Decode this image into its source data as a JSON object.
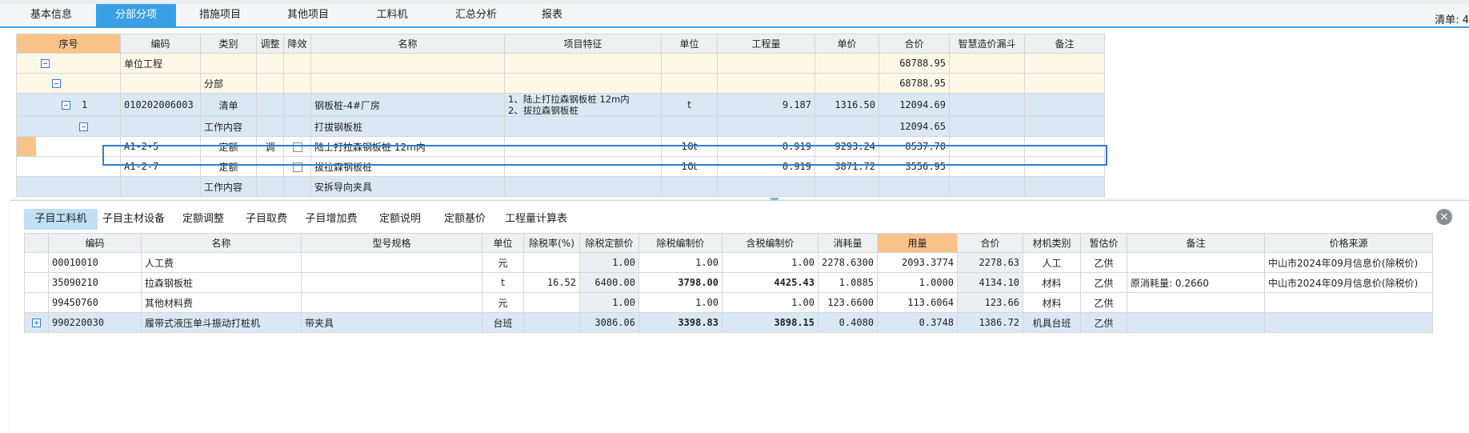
{
  "top_tabs": [
    "基本信息",
    "分部分项",
    "措施项目",
    "其他项目",
    "工料机",
    "汇总分析",
    "报表"
  ],
  "active_top_tab": "分部分项",
  "list_right_label": "清单: 4",
  "upper_table": {
    "headers": [
      "序号",
      "编码",
      "类别",
      "调整",
      "降效",
      "名称",
      "项目特征",
      "单位",
      "工程量",
      "单价",
      "合价",
      "智慧造价漏斗",
      "备注"
    ],
    "rows": [
      {
        "seq": "",
        "code": "单位工程",
        "type": "",
        "adjust": "",
        "reduce": "",
        "name": "",
        "feature": "",
        "unit": "",
        "qty": "",
        "price": "",
        "total": "68788.95"
      },
      {
        "seq": "",
        "code": "",
        "type": "分部",
        "adjust": "",
        "reduce": "",
        "name": "",
        "feature": "",
        "unit": "",
        "qty": "",
        "price": "",
        "total": "68788.95"
      },
      {
        "seq": "1",
        "code": "010202006003",
        "type": "清单",
        "adjust": "",
        "reduce": "",
        "name": "钢板桩-4#厂房",
        "feature_1": "1、陆上打拉森钢板桩 12m内",
        "feature_2": "2、拔拉森钢板桩",
        "unit": "t",
        "qty": "9.187",
        "price": "1316.50",
        "total": "12094.69"
      },
      {
        "seq": "",
        "code": "",
        "type": "工作内容",
        "adjust": "",
        "reduce": "",
        "name": "打拔钢板桩",
        "feature": "",
        "unit": "",
        "qty": "",
        "price": "",
        "total": "12094.65"
      },
      {
        "seq": "",
        "code": "A1-2-5",
        "type": "定额",
        "adjust": "调",
        "reduce": "",
        "name": "陆上打拉森钢板桩 12m内",
        "feature": "",
        "unit": "10t",
        "qty": "0.919",
        "price": "9293.24",
        "total": "8537.70"
      },
      {
        "seq": "",
        "code": "A1-2-7",
        "type": "定额",
        "adjust": "",
        "reduce": "",
        "name": "拔拉森钢板桩",
        "feature": "",
        "unit": "10t",
        "qty": "0.919",
        "price": "3871.72",
        "total": "3556.95"
      },
      {
        "seq": "",
        "code": "",
        "type": "工作内容",
        "adjust": "",
        "reduce": "",
        "name": "安拆导向夹具",
        "feature": "",
        "unit": "",
        "qty": "",
        "price": "",
        "total": ""
      }
    ]
  },
  "sub_tabs": [
    "子目工料机",
    "子目主材设备",
    "定额调整",
    "子目取费",
    "子目增加费",
    "定额说明",
    "定额基价",
    "工程量计算表"
  ],
  "active_sub_tab": "子目工料机",
  "close_icon": "×",
  "lower_table": {
    "headers": [
      "编码",
      "名称",
      "型号规格",
      "单位",
      "除税率(%)",
      "除税定额价",
      "除税编制价",
      "含税编制价",
      "消耗量",
      "用量",
      "合价",
      "材机类别",
      "暂估价",
      "备注",
      "价格来源"
    ],
    "rows": [
      {
        "code": "00010010",
        "name": "人工费",
        "spec": "",
        "unit": "元",
        "tax_rate": "",
        "quota_price": "1.00",
        "prep_price": "1.00",
        "tax_prep_price": "1.00",
        "consumption": "2278.6300",
        "usage": "2093.3774",
        "total": "2278.63",
        "category": "人工",
        "provisional": "乙供",
        "note": "",
        "source": "中山市2024年09月信息价(除税价)"
      },
      {
        "code": "35090210",
        "name": "拉森钢板桩",
        "spec": "",
        "unit": "t",
        "tax_rate": "16.52",
        "quota_price": "6400.00",
        "prep_price": "3798.00",
        "tax_prep_price": "4425.43",
        "consumption": "1.0885",
        "usage": "1.0000",
        "total": "4134.10",
        "category": "材料",
        "provisional": "乙供",
        "note": "原消耗量: 0.2660",
        "source": "中山市2024年09月信息价(除税价)"
      },
      {
        "code": "99450760",
        "name": "其他材料费",
        "spec": "",
        "unit": "元",
        "tax_rate": "",
        "quota_price": "1.00",
        "prep_price": "1.00",
        "tax_prep_price": "1.00",
        "consumption": "123.6600",
        "usage": "113.6064",
        "total": "123.66",
        "category": "材料",
        "provisional": "乙供",
        "note": "",
        "source": ""
      },
      {
        "code": "990220030",
        "name": "履带式液压单斗振动打桩机",
        "spec": "带夹具",
        "unit": "台班",
        "tax_rate": "",
        "quota_price": "3086.06",
        "prep_price": "3398.83",
        "tax_prep_price": "3898.15",
        "consumption": "0.4080",
        "usage": "0.3748",
        "total": "1386.72",
        "category": "机具台班",
        "provisional": "乙供",
        "note": "",
        "source": ""
      }
    ]
  }
}
